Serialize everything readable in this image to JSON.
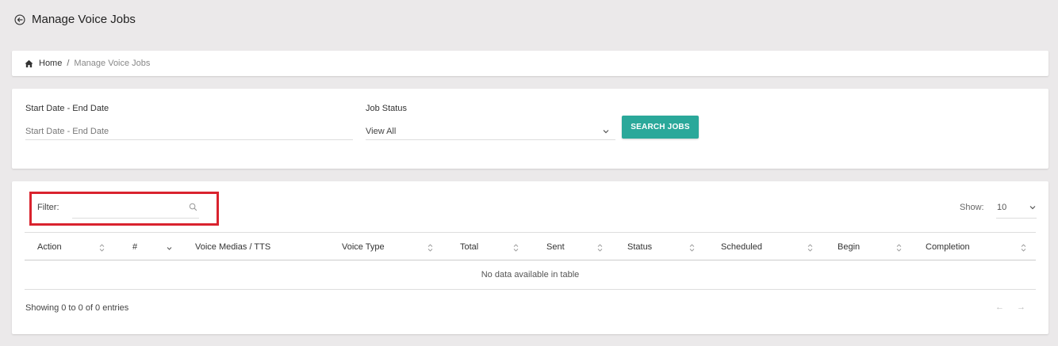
{
  "header": {
    "title": "Manage Voice Jobs",
    "back_icon": "arrow-left-circle-icon"
  },
  "breadcrumb": {
    "home": "Home",
    "separator": "/",
    "current": "Manage Voice Jobs",
    "home_icon": "home-icon"
  },
  "search": {
    "date_label": "Start Date - End Date",
    "date_placeholder": "Start Date - End Date",
    "status_label": "Job Status",
    "status_value": "View All",
    "button_label": "SEARCH JOBS",
    "button_color": "#2aa89a"
  },
  "table": {
    "filter_label": "Filter:",
    "filter_value": "",
    "show_label": "Show:",
    "show_value": "10",
    "columns": [
      "Action",
      "#",
      "Voice Medias / TTS",
      "Voice Type",
      "Total",
      "Sent",
      "Status",
      "Scheduled",
      "Begin",
      "Completion"
    ],
    "empty_message": "No data available in table",
    "info": "Showing 0 to 0 of 0 entries",
    "pager_prev": "←",
    "pager_next": "→",
    "highlight_color": "#d9232e"
  }
}
